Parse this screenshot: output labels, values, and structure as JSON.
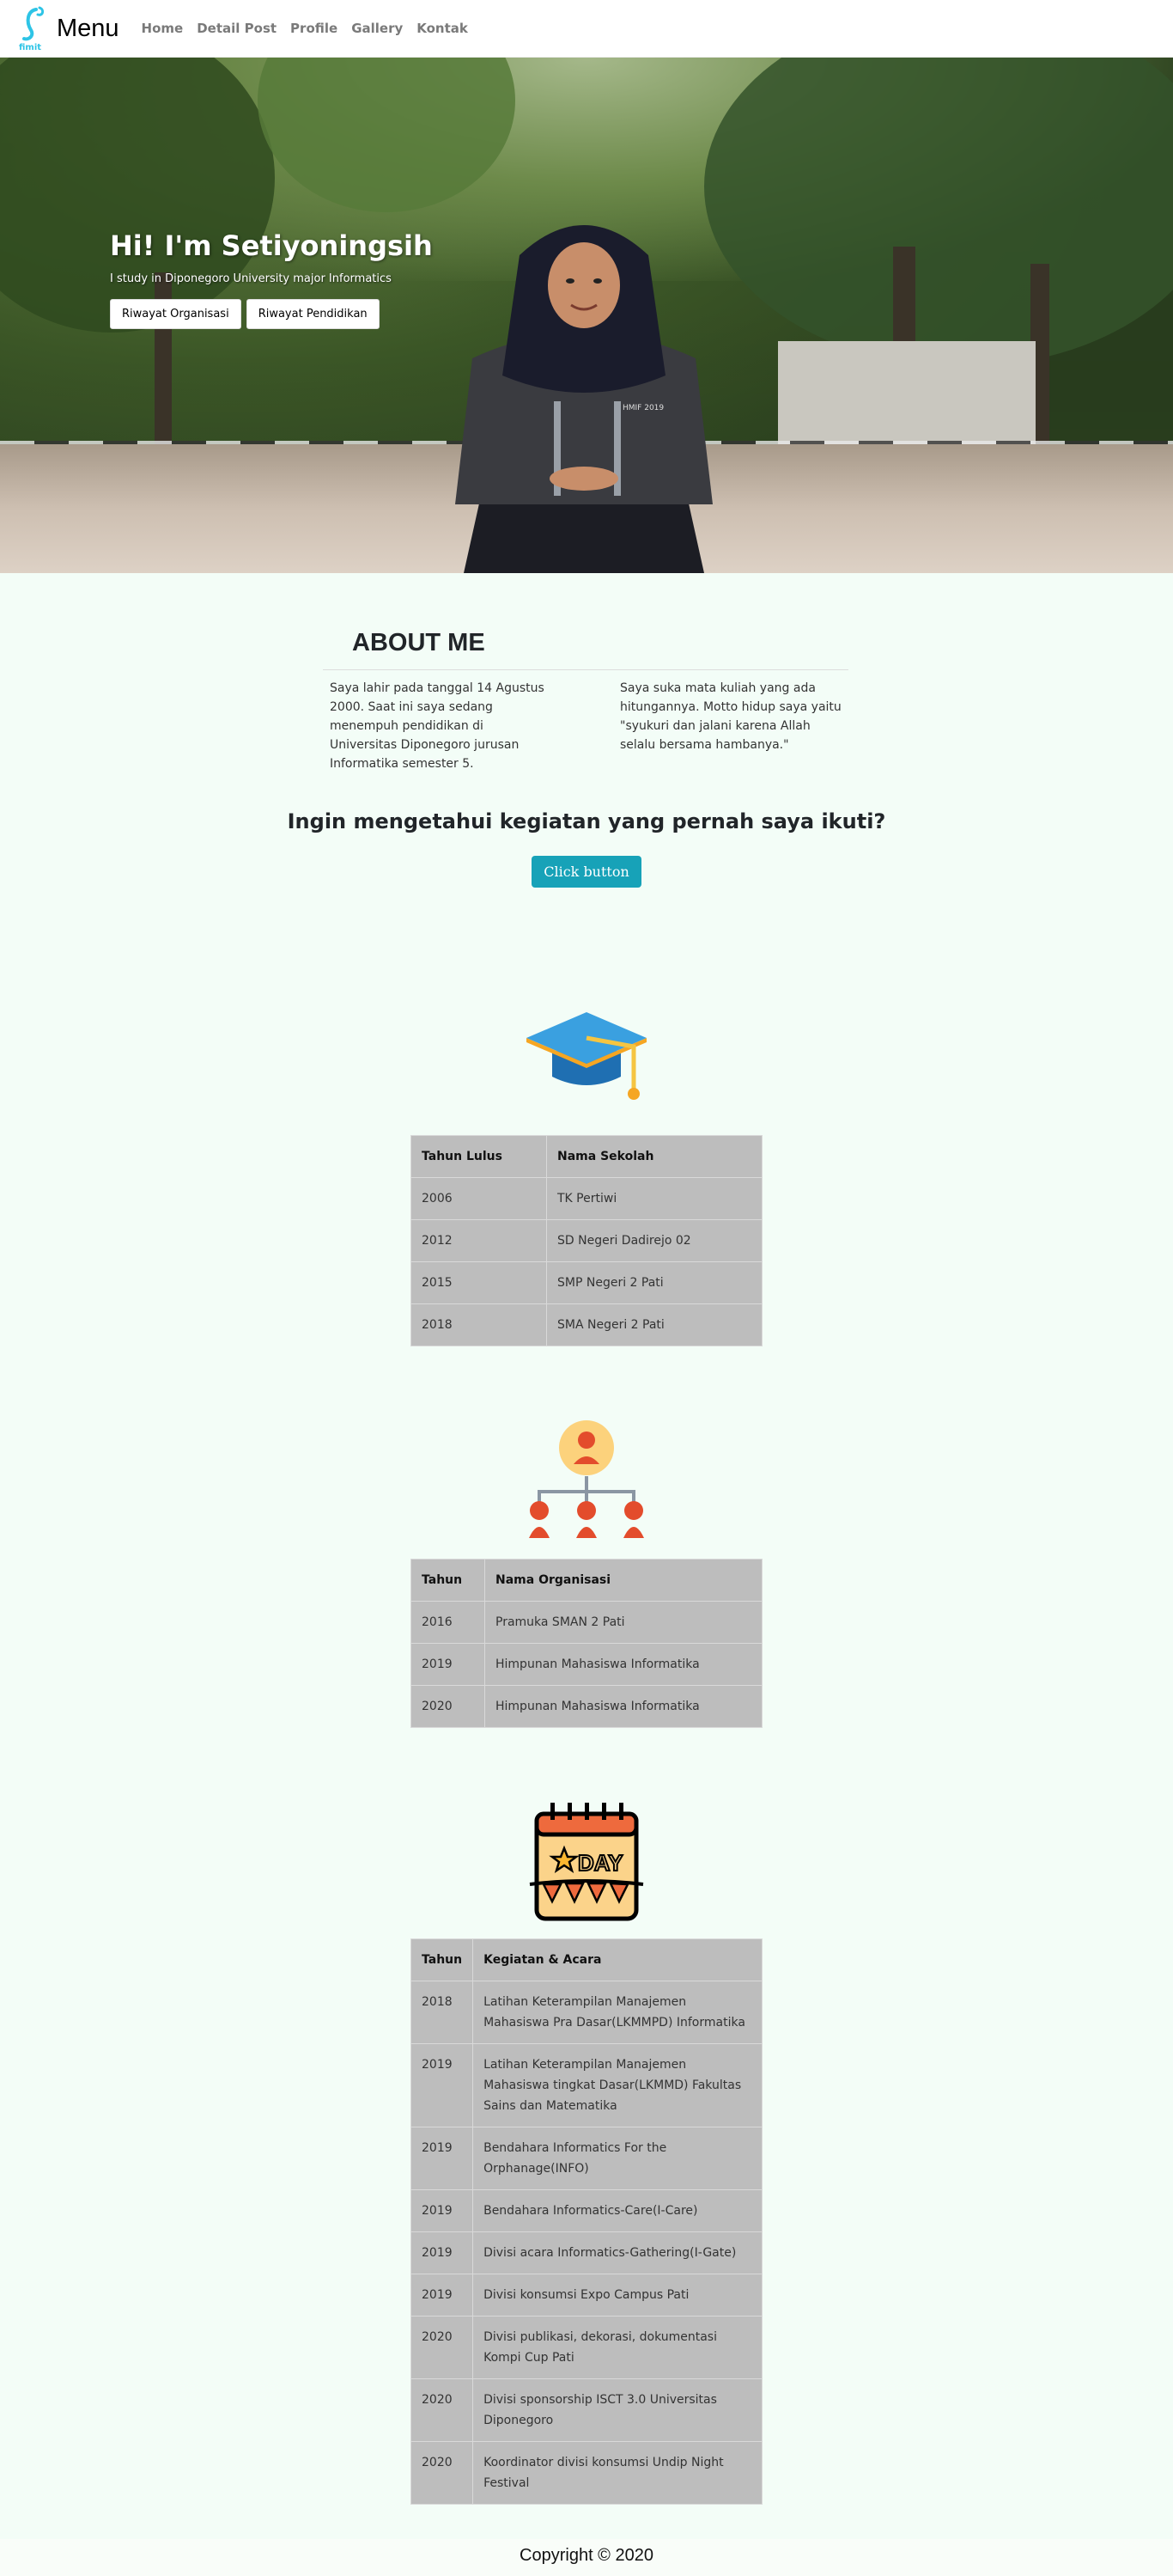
{
  "navbar": {
    "logo_text": "fimit",
    "brand": "Menu",
    "links": [
      "Home",
      "Detail Post",
      "Profile",
      "Gallery",
      "Kontak"
    ]
  },
  "hero": {
    "title": "Hi! I'm Setiyoningsih",
    "subtitle": "I study in Diponegoro University major Informatics",
    "buttons": [
      "Riwayat Organisasi",
      "Riwayat Pendidikan"
    ],
    "jacket_text": "HMIF 2019"
  },
  "about": {
    "title": "ABOUT ME",
    "col1": "Saya lahir pada tanggal 14 Agustus 2000. Saat ini saya sedang menempuh pendidikan di Universitas Diponegoro jurusan Informatika semester 5.",
    "col2": "Saya suka mata kuliah yang ada hitungannya. Motto hidup saya yaitu \"syukuri dan jalani karena Allah selalu bersama hambanya.\"",
    "question": "Ingin mengetahui kegiatan yang pernah saya ikuti?",
    "button": "Click button"
  },
  "education": {
    "icon": "graduation-cap-icon",
    "headers": [
      "Tahun Lulus",
      "Nama Sekolah"
    ],
    "rows": [
      [
        "2006",
        "TK Pertiwi"
      ],
      [
        "2012",
        "SD Negeri Dadirejo 02"
      ],
      [
        "2015",
        "SMP Negeri 2 Pati"
      ],
      [
        "2018",
        "SMA Negeri 2 Pati"
      ]
    ]
  },
  "organization": {
    "icon": "org-chart-icon",
    "headers": [
      "Tahun",
      "Nama Organisasi"
    ],
    "rows": [
      [
        "2016",
        "Pramuka SMAN 2 Pati"
      ],
      [
        "2019",
        "Himpunan Mahasiswa Informatika"
      ],
      [
        "2020",
        "Himpunan Mahasiswa Informatika"
      ]
    ]
  },
  "events": {
    "icon": "calendar-day-icon",
    "icon_text": "DAY",
    "headers": [
      "Tahun",
      "Kegiatan & Acara"
    ],
    "rows": [
      [
        "2018",
        "Latihan Keterampilan Manajemen Mahasiswa Pra Dasar(LKMMPD) Informatika"
      ],
      [
        "2019",
        "Latihan Keterampilan Manajemen Mahasiswa tingkat Dasar(LKMMD) Fakultas Sains dan Matematika"
      ],
      [
        "2019",
        "Bendahara Informatics For the Orphanage(INFO)"
      ],
      [
        "2019",
        "Bendahara Informatics-Care(I-Care)"
      ],
      [
        "2019",
        "Divisi acara Informatics-Gathering(I-Gate)"
      ],
      [
        "2019",
        "Divisi konsumsi Expo Campus Pati"
      ],
      [
        "2020",
        "Divisi publikasi, dekorasi, dokumentasi Kompi Cup Pati"
      ],
      [
        "2020",
        "Divisi sponsorship ISCT 3.0 Universitas Diponegoro"
      ],
      [
        "2020",
        "Koordinator divisi konsumsi Undip Night Festival"
      ]
    ]
  },
  "footer": {
    "text": "Copyright © 2020"
  },
  "colors": {
    "page_bg": "#f3fdf7",
    "accent_button": "#17a2b8",
    "table_bg": "#bdbdbd"
  }
}
